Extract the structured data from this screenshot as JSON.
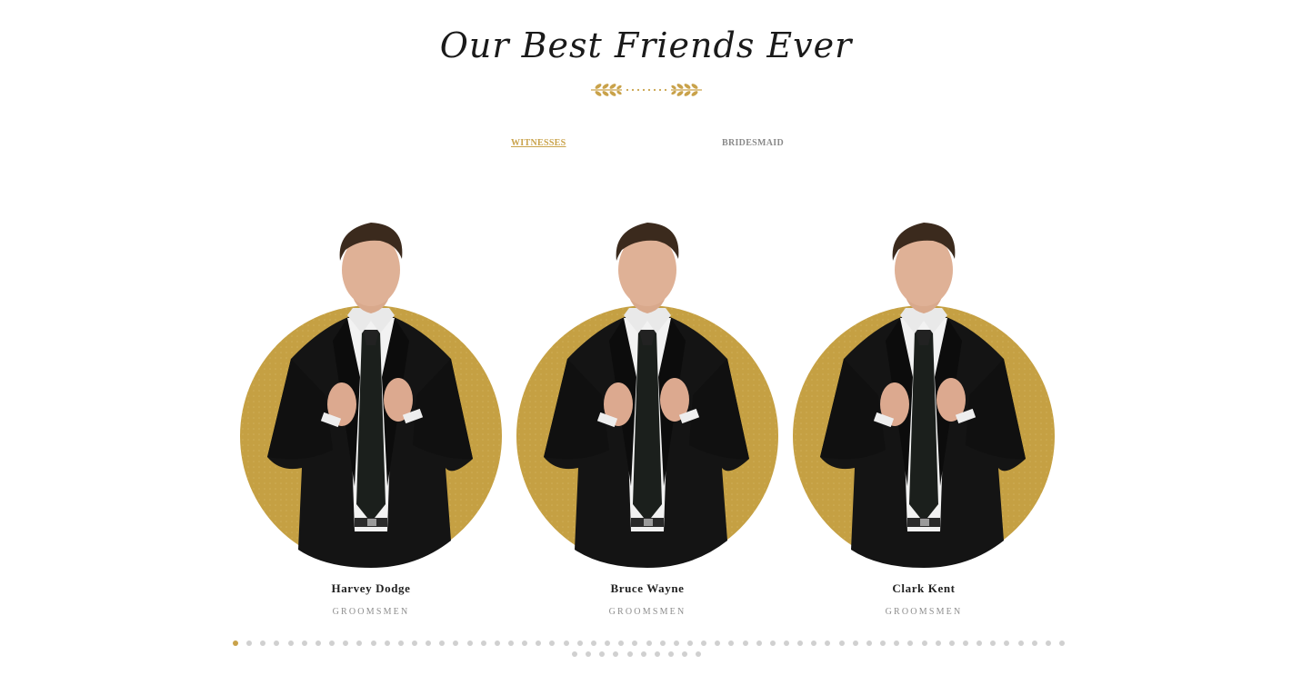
{
  "section": {
    "title": "Our Best Friends Ever"
  },
  "tabs": [
    {
      "label": "WITNESSES",
      "active": true
    },
    {
      "label": "BRIDESMAID",
      "active": false
    }
  ],
  "cards": [
    {
      "name": "Harvey Dodge",
      "role": "GROOMSMEN"
    },
    {
      "name": "Bruce Wayne",
      "role": "GROOMSMEN"
    },
    {
      "name": "Clark Kent",
      "role": "GROOMSMEN"
    }
  ],
  "colors": {
    "accent": "#c9a24a",
    "circle": "#c5a043",
    "suit": "#141414",
    "dot_inactive": "#d0d0d0"
  },
  "pagination": {
    "total_dots": 71,
    "active_index": 0
  }
}
